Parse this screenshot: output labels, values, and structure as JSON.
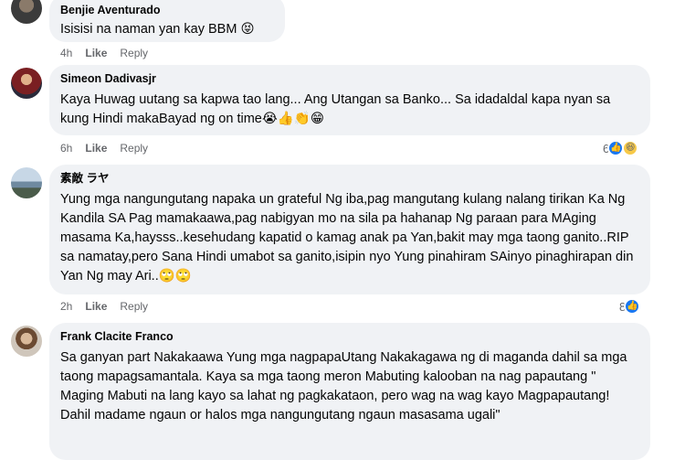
{
  "labels": {
    "like": "Like",
    "reply": "Reply"
  },
  "comments": [
    {
      "author": "Benjie Aventurado",
      "text": "Isisisi na naman yan kay BBM 😝",
      "time": "4h",
      "reaction_count": ""
    },
    {
      "author": "Simeon Dadivasjr",
      "text": "Kaya Huwag uutang sa kapwa tao lang... Ang Utangan sa Banko... Sa idadaldal kapa nyan sa kung Hindi makaBayad ng on time😭👍👏😁",
      "time": "6h",
      "reaction_count": "6"
    },
    {
      "author": "素敵 ラヤ",
      "text": "Yung mga nangungutang napaka un grateful Ng iba,pag mangutang kulang nalang tirikan Ka Ng Kandila SA Pag mamakaawa,pag nabigyan mo na sila pa hahanap Ng paraan para MAging masama Ka,haysss..kesehudang kapatid o kamag anak pa Yan,bakit may mga taong ganito..RIP sa namatay,pero Sana Hindi umabot sa ganito,isipin nyo Yung pinahiram SAinyo pinaghirapan din Yan Ng may Ari..🙄🙄",
      "time": "2h",
      "reaction_count": "8"
    },
    {
      "author": "Frank Clacite Franco",
      "text": "Sa ganyan part Nakakaawa Yung mga nagpapaUtang Nakakagawa ng di maganda dahil sa mga taong mapagsamantala. Kaya sa mga taong meron Mabuting kalooban na nag papautang \" Maging Mabuti na lang kayo sa lahat ng pagkakataon, pero wag na wag kayo Magpapautang! Dahil madame ngaun or halos mga nangungutang ngaun masasama ugali\"",
      "time": "",
      "reaction_count": ""
    }
  ],
  "colors": {
    "bubble": "#f0f2f5",
    "meta_text": "#65676b",
    "like_blue": "#1877f2",
    "haha_yellow": "#f7c948"
  },
  "icons": [
    "like-reaction-icon",
    "haha-reaction-icon"
  ]
}
